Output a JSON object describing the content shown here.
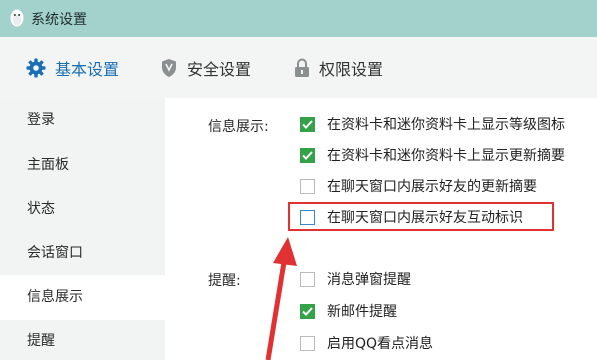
{
  "window": {
    "title": "系统设置",
    "app_icon": "penguin-icon"
  },
  "tabs": [
    {
      "label": "基本设置",
      "icon": "gear-icon",
      "active": true
    },
    {
      "label": "安全设置",
      "icon": "shield-icon",
      "active": false
    },
    {
      "label": "权限设置",
      "icon": "lock-icon",
      "active": false
    }
  ],
  "sidebar": {
    "items": [
      {
        "label": "登录"
      },
      {
        "label": "主面板"
      },
      {
        "label": "状态"
      },
      {
        "label": "会话窗口"
      },
      {
        "label": "信息展示",
        "active": true
      },
      {
        "label": "提醒"
      }
    ]
  },
  "content": {
    "info_display": {
      "label": "信息展示:",
      "options": [
        {
          "label": "在资料卡和迷你资料卡上显示等级图标",
          "checked": true
        },
        {
          "label": "在资料卡和迷你资料卡上显示更新摘要",
          "checked": true
        },
        {
          "label": "在聊天窗口内展示好友的更新摘要",
          "checked": false
        },
        {
          "label": "在聊天窗口内展示好友互动标识",
          "checked": false,
          "highlighted": true
        }
      ]
    },
    "reminder": {
      "label": "提醒:",
      "options": [
        {
          "label": "消息弹窗提醒",
          "checked": false
        },
        {
          "label": "新邮件提醒",
          "checked": true
        },
        {
          "label": "启用QQ看点消息",
          "checked": false
        }
      ]
    }
  },
  "colors": {
    "titlebar": "#a3d2cd",
    "accent_blue": "#1a6fb4",
    "checked_green": "#33a249",
    "highlight_red": "#e03232"
  }
}
